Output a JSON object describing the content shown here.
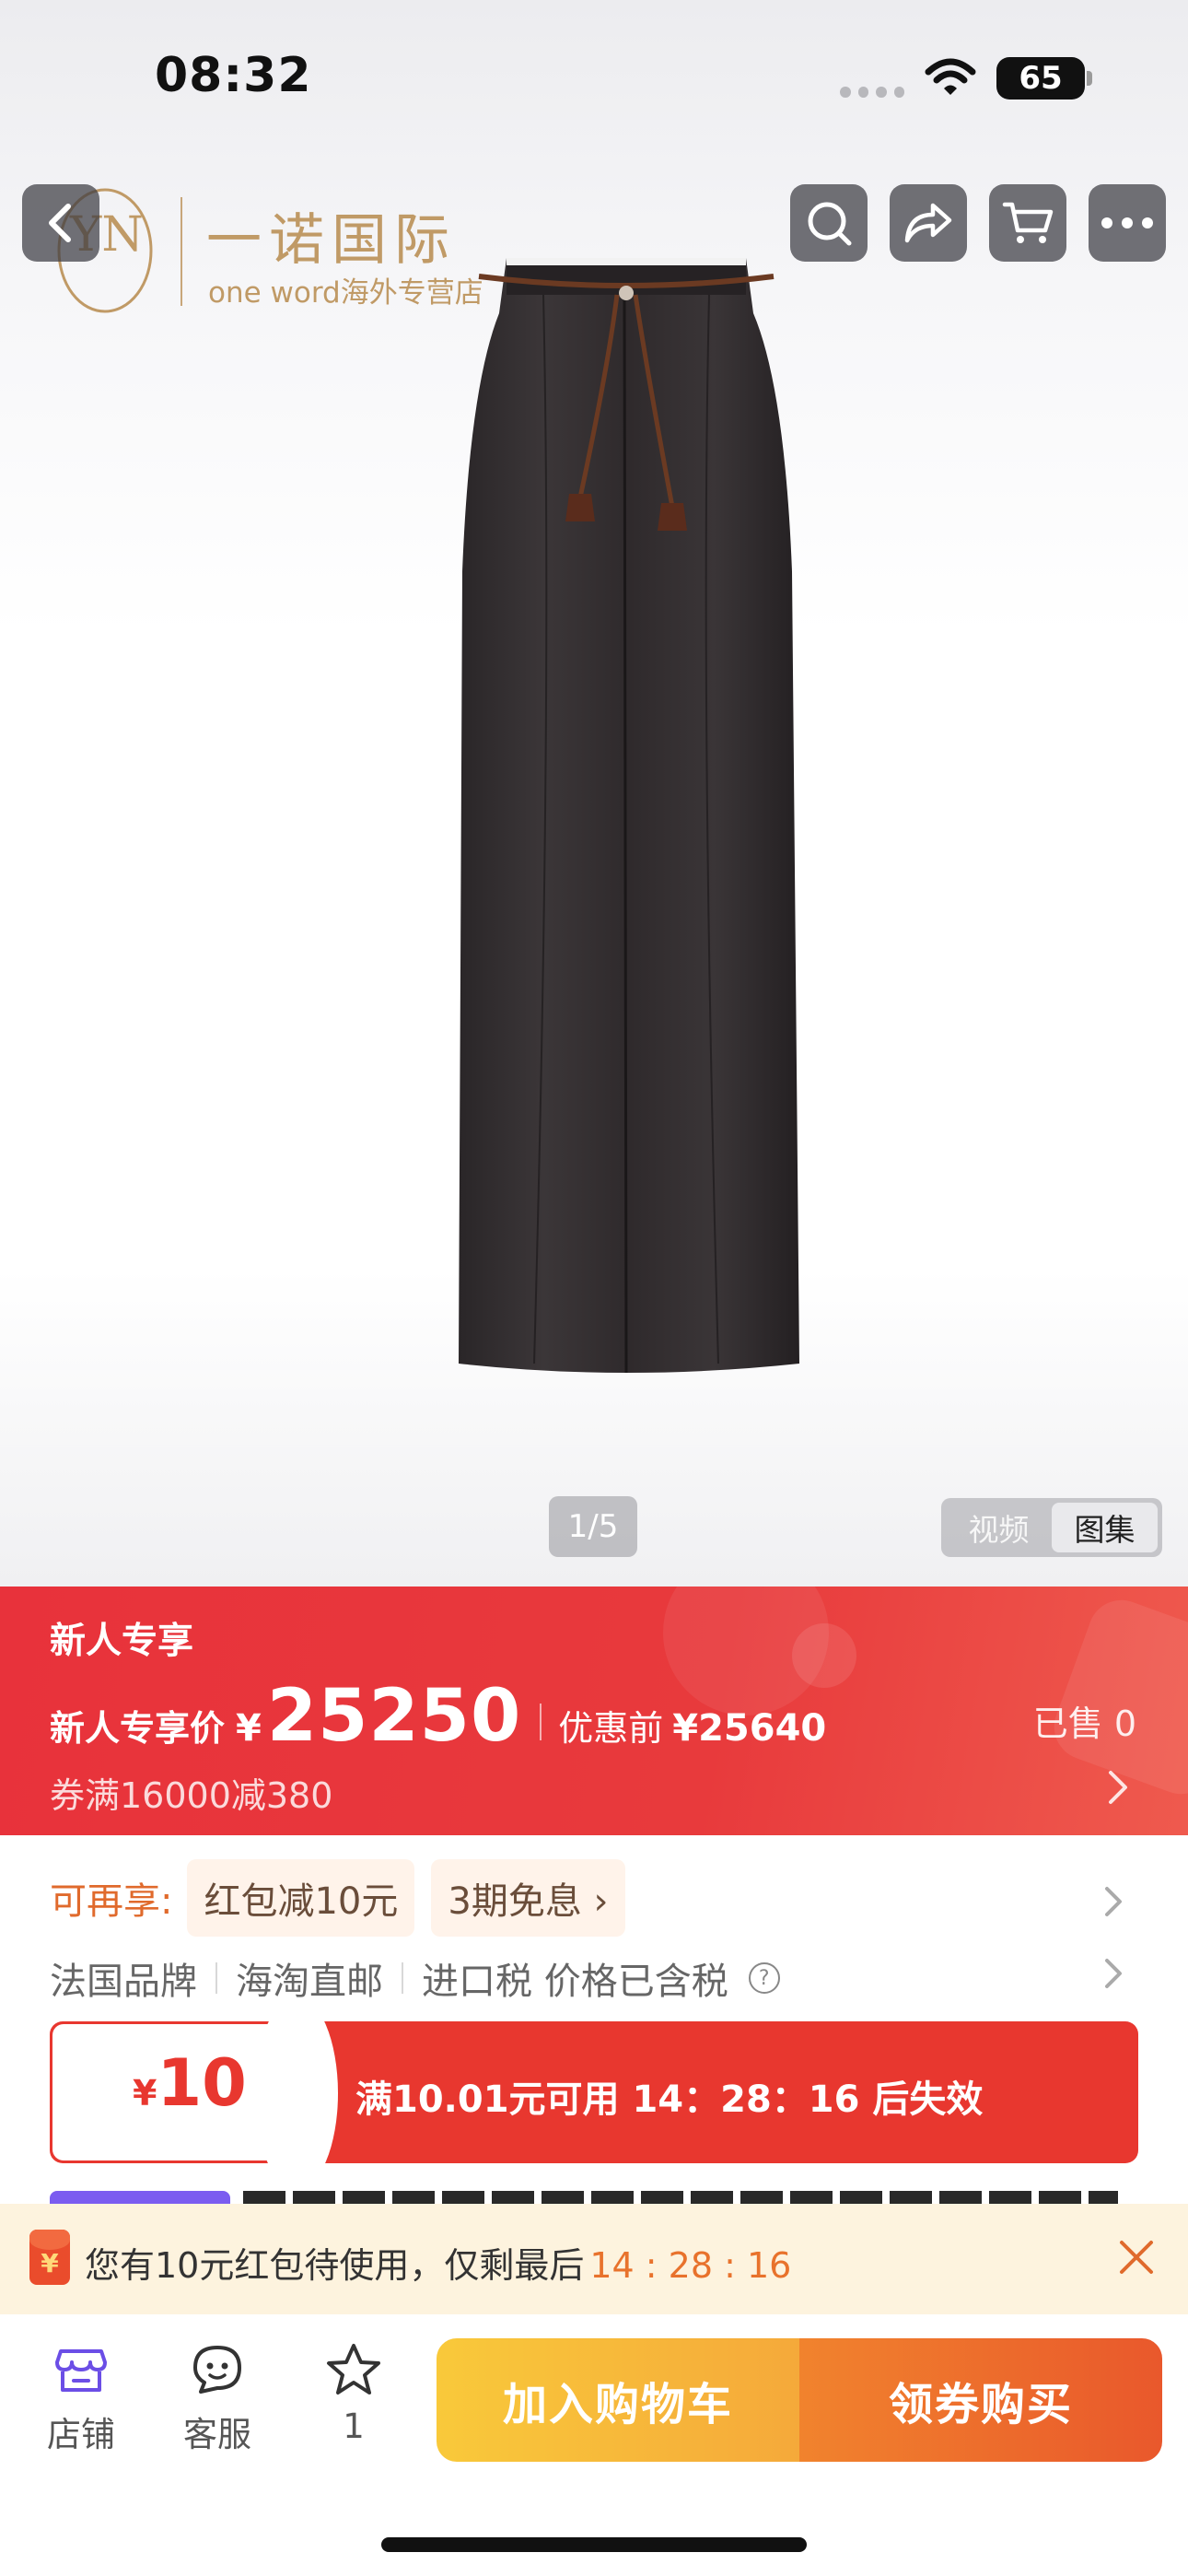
{
  "status_bar": {
    "time": "08:32",
    "battery": "65"
  },
  "store_logo": {
    "mark": "YN",
    "name_cn": "一诺国际",
    "name_en": "one word海外专营店"
  },
  "gallery": {
    "page_indicator": "1/5",
    "tabs": [
      "视频",
      "图集"
    ],
    "active_tab": "图集"
  },
  "price_banner": {
    "tag": "新人专享",
    "price_label": "新人专享价",
    "currency": "¥",
    "price": "25250",
    "original_label": "优惠前",
    "original_price": "¥25640",
    "sold": "已售 0",
    "coupon_rule": "券满16000减380"
  },
  "benefits": {
    "label": "可再享:",
    "chips": [
      "红包减10元",
      "3期免息 ›"
    ],
    "info": [
      "法国品牌",
      "海淘直邮",
      "进口税 价格已含税"
    ],
    "help_icon": "?"
  },
  "coupon": {
    "currency": "¥",
    "amount": "10",
    "text": "满10.01元可用  14：28：16 后失效"
  },
  "notice": {
    "icon_text": "¥",
    "text": "您有10元红包待使用，仅剩最后",
    "timer": "14 : 28 : 16"
  },
  "bottom_bar": {
    "store": "店铺",
    "service": "客服",
    "favorite_count": "1",
    "add_to_cart": "加入购物车",
    "buy": "领券购买"
  },
  "colors": {
    "price_red": "#e8323b",
    "accent_orange": "#e8722c",
    "cta_yellow": "#f9c93a",
    "cta_orange": "#e9582c",
    "store_purple": "#7b5cf0"
  }
}
